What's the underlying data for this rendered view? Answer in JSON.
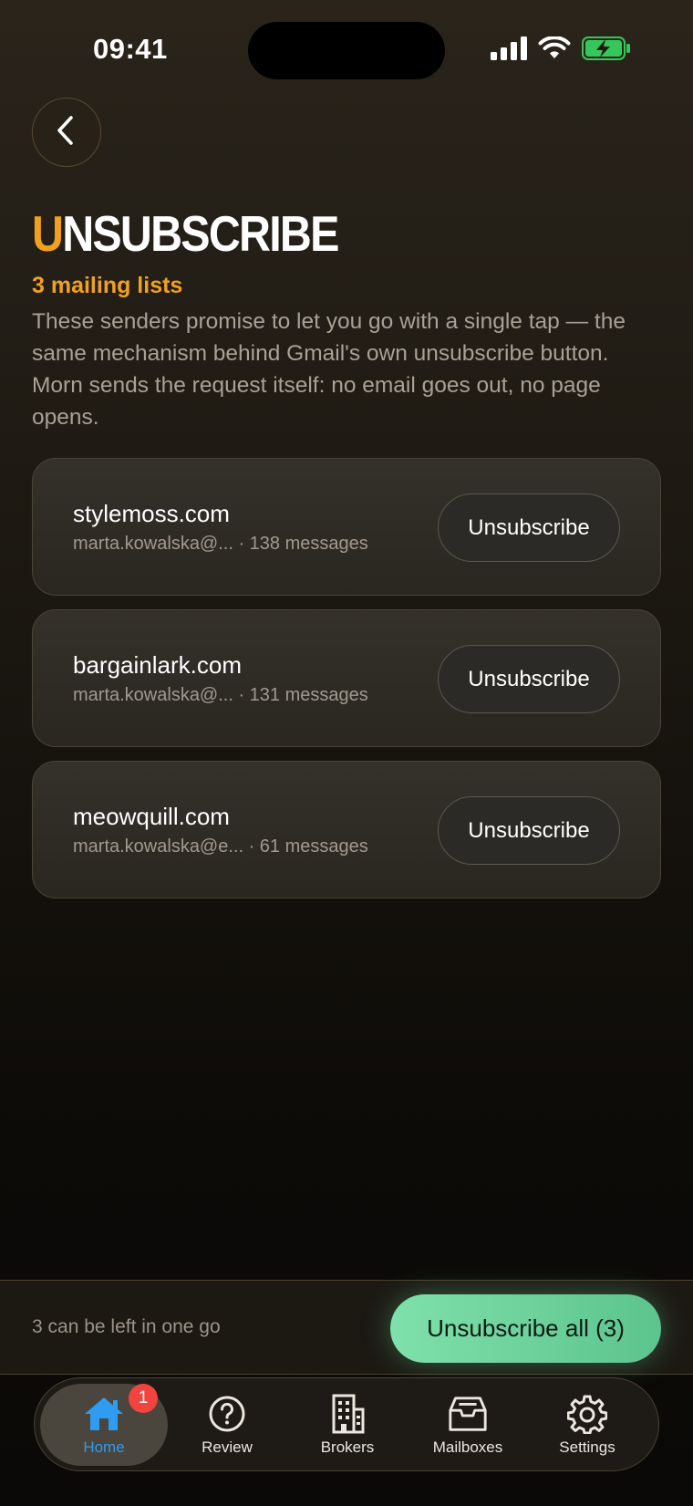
{
  "status_bar": {
    "time": "09:41"
  },
  "header": {
    "title_first_letter": "U",
    "title_rest": "NSUBSCRIBE",
    "count_label": "3 mailing lists",
    "description": "These senders promise to let you go with a single tap — the same mechanism behind Gmail's own unsubscribe button. Morn sends the request itself: no email goes out, no page opens."
  },
  "mailing_lists": [
    {
      "domain": "stylemoss.com",
      "meta": "marta.kowalska@... · 138 messages",
      "button_label": "Unsubscribe"
    },
    {
      "domain": "bargainlark.com",
      "meta": "marta.kowalska@... · 131 messages",
      "button_label": "Unsubscribe"
    },
    {
      "domain": "meowquill.com",
      "meta": "marta.kowalska@e... · 61 messages",
      "button_label": "Unsubscribe"
    }
  ],
  "action_bar": {
    "hint": "3 can be left in one go",
    "button_label": "Unsubscribe all (3)"
  },
  "tab_bar": {
    "tabs": [
      {
        "label": "Home",
        "icon": "home-icon",
        "active": true,
        "badge": "1"
      },
      {
        "label": "Review",
        "icon": "question-icon"
      },
      {
        "label": "Brokers",
        "icon": "building-icon"
      },
      {
        "label": "Mailboxes",
        "icon": "inbox-icon"
      },
      {
        "label": "Settings",
        "icon": "gear-icon"
      }
    ]
  },
  "colors": {
    "accent": "#f2a11f",
    "primary_action": "#6fd39c",
    "active_tab": "#2e9cf0",
    "badge": "#f0443e"
  }
}
